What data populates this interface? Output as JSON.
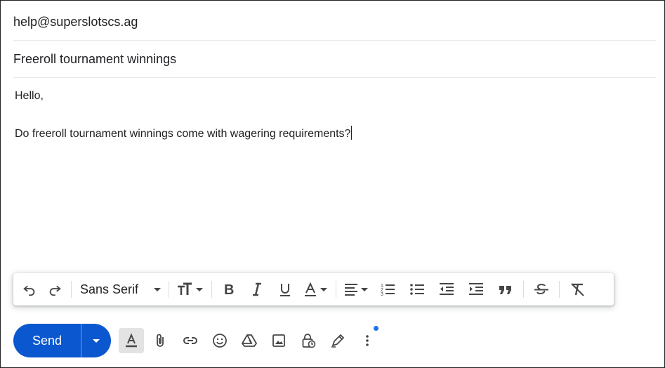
{
  "compose": {
    "to": "help@superslotscs.ag",
    "subject": "Freeroll tournament winnings",
    "body_greeting": "Hello,",
    "body_text": "Do freeroll tournament winnings come with wagering requirements?"
  },
  "format_toolbar": {
    "font": "Sans Serif",
    "icons": [
      "undo-icon",
      "redo-icon",
      "font-dropdown",
      "text-size-icon",
      "bold-icon",
      "italic-icon",
      "underline-icon",
      "text-color-icon",
      "align-icon",
      "numbered-list-icon",
      "bulleted-list-icon",
      "indent-less-icon",
      "indent-more-icon",
      "quote-icon",
      "strikethrough-icon",
      "remove-formatting-icon"
    ]
  },
  "actions": {
    "send_label": "Send",
    "icons": [
      "formatting-options-icon",
      "attach-icon",
      "link-icon",
      "emoji-icon",
      "drive-icon",
      "photo-icon",
      "confidential-mode-icon",
      "signature-icon",
      "more-options-icon"
    ],
    "accent_color": "#0b57d0",
    "notification_dot_color": "#1a73e8"
  }
}
